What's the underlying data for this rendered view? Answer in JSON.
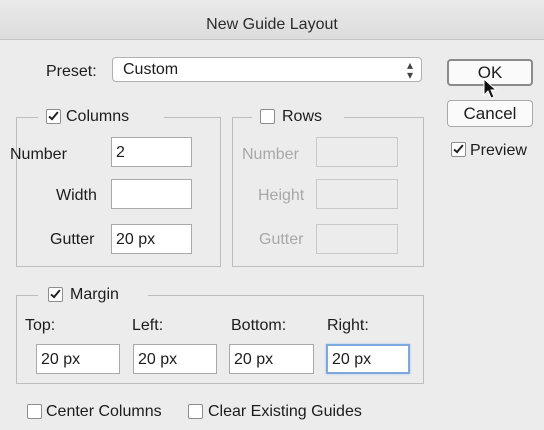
{
  "window": {
    "title": "New Guide Layout"
  },
  "preset": {
    "label": "Preset:",
    "value": "Custom"
  },
  "buttons": {
    "ok": "OK",
    "cancel": "Cancel"
  },
  "preview": {
    "label": "Preview",
    "checked": true
  },
  "columns": {
    "label": "Columns",
    "checked": true,
    "number_label": "Number",
    "number_value": "2",
    "width_label": "Width",
    "width_value": "",
    "gutter_label": "Gutter",
    "gutter_value": "20 px"
  },
  "rows": {
    "label": "Rows",
    "checked": false,
    "number_label": "Number",
    "number_value": "",
    "height_label": "Height",
    "height_value": "",
    "gutter_label": "Gutter",
    "gutter_value": ""
  },
  "margin": {
    "label": "Margin",
    "checked": true,
    "top_label": "Top:",
    "top_value": "20 px",
    "left_label": "Left:",
    "left_value": "20 px",
    "bottom_label": "Bottom:",
    "bottom_value": "20 px",
    "right_label": "Right:",
    "right_value": "20 px"
  },
  "options": {
    "center_columns_label": "Center Columns",
    "center_columns_checked": false,
    "clear_guides_label": "Clear Existing Guides",
    "clear_guides_checked": false
  },
  "icons": {
    "cursor": "mouse-pointer-icon",
    "select_arrows": "updown-arrows-icon",
    "checkmark": "checkmark-icon"
  }
}
